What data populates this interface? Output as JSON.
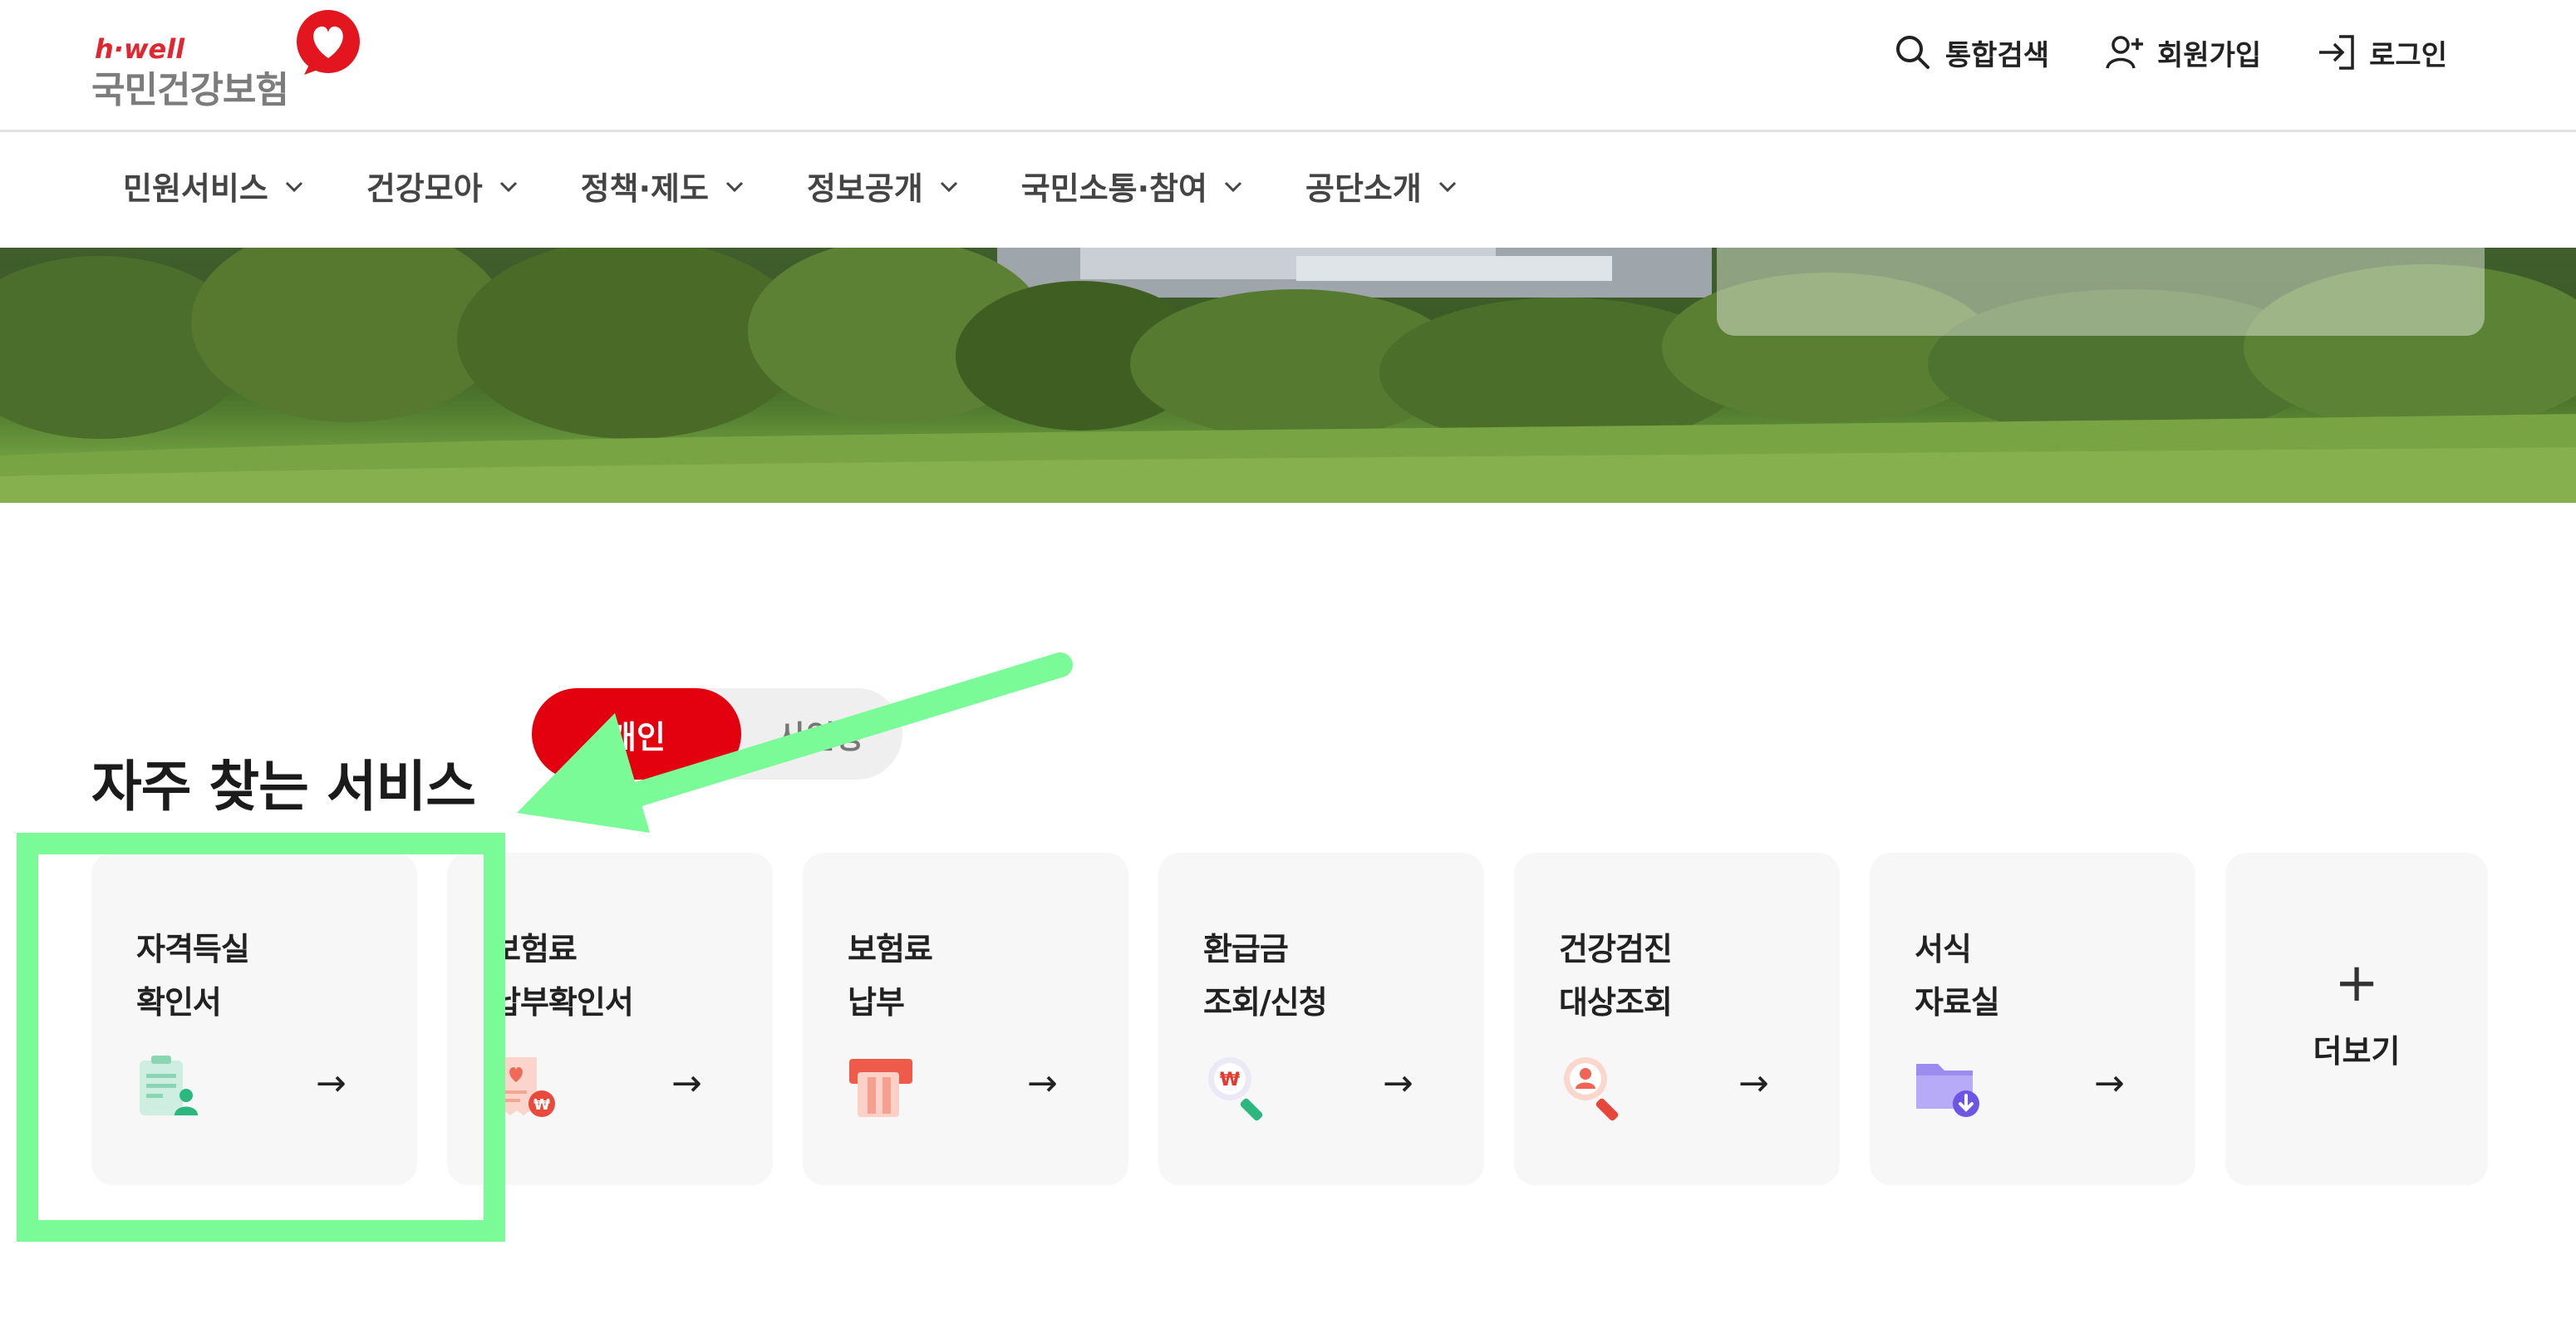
{
  "header": {
    "logo": {
      "brand_small": "h·well",
      "brand_main": "국민건강보험",
      "icon": "heart-icon"
    },
    "utility_nav": [
      {
        "label": "통합검색",
        "icon": "search-icon"
      },
      {
        "label": "회원가입",
        "icon": "user-plus-icon"
      },
      {
        "label": "로그인",
        "icon": "login-icon"
      }
    ]
  },
  "gnb": [
    {
      "label": "민원서비스"
    },
    {
      "label": "건강모아"
    },
    {
      "label": "정책·제도"
    },
    {
      "label": "정보공개"
    },
    {
      "label": "국민소통·참여"
    },
    {
      "label": "공단소개"
    }
  ],
  "services": {
    "title": "자주 찾는 서비스",
    "tabs": {
      "personal": "개인",
      "business": "사업장",
      "active": "personal"
    },
    "cards": [
      {
        "line1": "자격득실",
        "line2": "확인서",
        "icon": "id-certificate-icon",
        "arrow": "→"
      },
      {
        "line1": "보험료",
        "line2": "납부확인서",
        "icon": "receipt-won-icon",
        "arrow": "→"
      },
      {
        "line1": "보험료",
        "line2": "납부",
        "icon": "card-payment-icon",
        "arrow": "→"
      },
      {
        "line1": "환급금",
        "line2": "조회/신청",
        "icon": "search-won-icon",
        "arrow": "→"
      },
      {
        "line1": "건강검진",
        "line2": "대상조회",
        "icon": "search-person-icon",
        "arrow": "→"
      },
      {
        "line1": "서식",
        "line2": "자료실",
        "icon": "folder-download-icon",
        "arrow": "→"
      }
    ],
    "more": {
      "plus": "+",
      "label": "더보기"
    }
  },
  "colors": {
    "accent": "#e3000f",
    "annotation": "#7bfb98",
    "card_bg": "#f7f7f7"
  }
}
